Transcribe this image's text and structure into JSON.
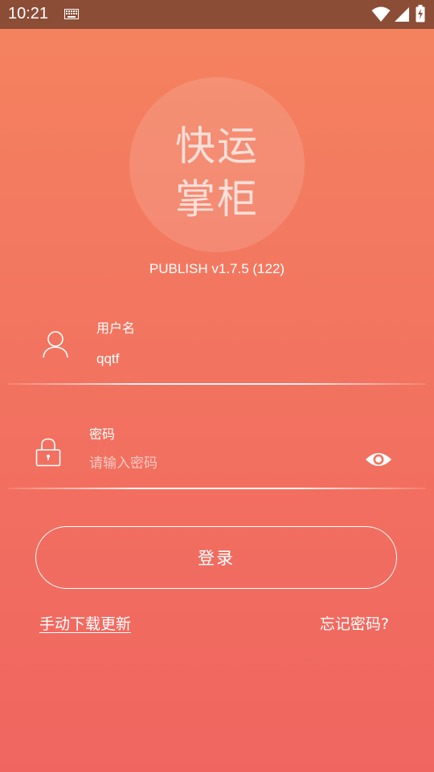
{
  "status_bar": {
    "time": "10:21"
  },
  "logo": {
    "line1": "快运",
    "line2": "掌柜"
  },
  "version": "PUBLISH v1.7.5 (122)",
  "username_field": {
    "label": "用户名",
    "value": "qqtf"
  },
  "password_field": {
    "label": "密码",
    "value": "",
    "placeholder": "请输入密码"
  },
  "login_button": {
    "label": "登录"
  },
  "links": {
    "download": "手动下载更新",
    "forgot": "忘记密码?"
  },
  "colors": {
    "background_top": "#f4835f",
    "background_bottom": "#f06560",
    "status_bar": "#8c4d37",
    "text": "#ffffff"
  },
  "icons": {
    "status": [
      "keyboard-icon",
      "wifi-icon",
      "signal-icon",
      "battery-icon"
    ],
    "username": "user-icon",
    "password": "lock-icon",
    "toggle_visibility": "eye-icon"
  }
}
